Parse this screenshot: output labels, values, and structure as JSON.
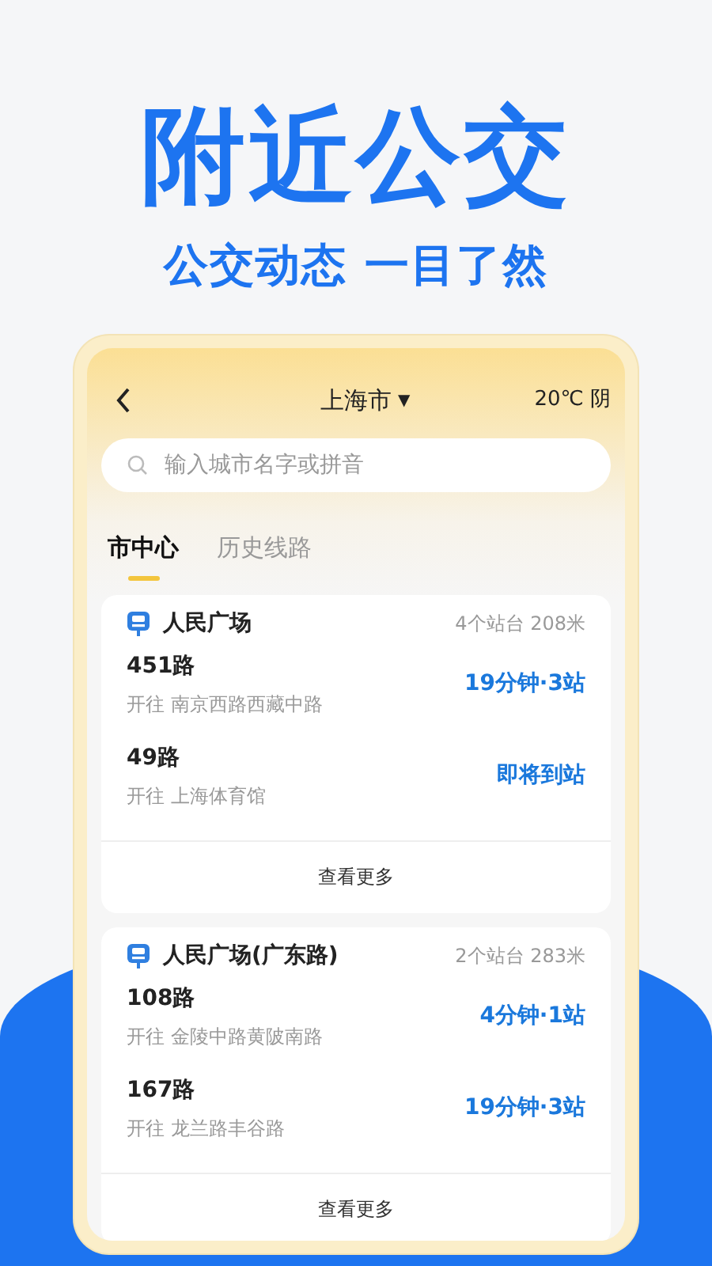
{
  "headline": "附近公交",
  "subheadline": "公交动态 一目了然",
  "screen": {
    "city": "上海市",
    "city_caret": "▼",
    "weather": "20℃ 阴",
    "search": {
      "placeholder": "输入城市名字或拼音"
    },
    "tabs": [
      {
        "label": "市中心",
        "selected": true
      },
      {
        "label": "历史线路",
        "selected": false
      }
    ],
    "stations": [
      {
        "name": "人民广场",
        "info": "4个站台 208米",
        "more": "查看更多",
        "routes": [
          {
            "route": "451路",
            "direction": "开往 南京西路西藏中路",
            "eta": "19分钟·3站"
          },
          {
            "route": "49路",
            "direction": "开往 上海体育馆",
            "eta": "即将到站"
          }
        ]
      },
      {
        "name": "人民广场(广东路)",
        "info": "2个站台 283米",
        "more": "查看更多",
        "routes": [
          {
            "route": "108路",
            "direction": "开往 金陵中路黄陂南路",
            "eta": "4分钟·1站"
          },
          {
            "route": "167路",
            "direction": "开往 龙兰路丰谷路",
            "eta": "19分钟·3站"
          }
        ]
      }
    ]
  }
}
